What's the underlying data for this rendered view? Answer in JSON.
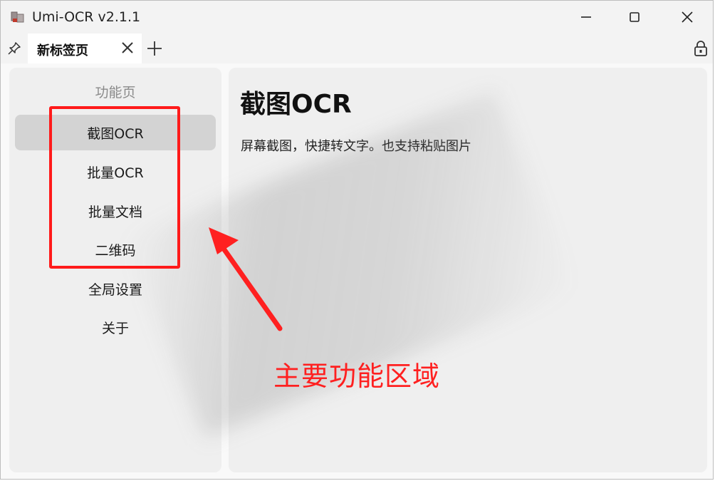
{
  "window": {
    "title": "Umi-OCR v2.1.1",
    "controls": [
      "minimize-icon",
      "maximize-icon",
      "close-icon"
    ]
  },
  "tabs": {
    "items": [
      {
        "label": "新标签页",
        "active": true
      }
    ],
    "add_icon": "plus-icon",
    "pin_icon": "pin-icon",
    "lock_icon": "lock-icon"
  },
  "sidebar": {
    "title": "功能页",
    "items": [
      {
        "label": "截图OCR",
        "active": true
      },
      {
        "label": "批量OCR"
      },
      {
        "label": "批量文档"
      },
      {
        "label": "二维码"
      },
      {
        "label": "全局设置"
      },
      {
        "label": "关于"
      }
    ]
  },
  "main": {
    "title": "截图OCR",
    "description": "屏幕截图，快捷转文字。也支持粘贴图片"
  },
  "annotation": {
    "label": "主要功能区域",
    "color": "#ff2020"
  }
}
